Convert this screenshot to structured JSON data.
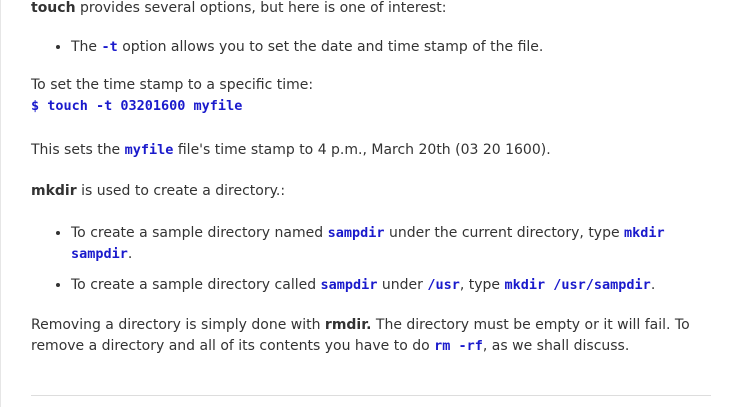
{
  "intro": {
    "cmd": "touch",
    "text": " provides several options, but here is one of interest:"
  },
  "list1": [
    {
      "pre": "The ",
      "code": "-t",
      "post": " option allows you to set the date and time stamp of the file."
    }
  ],
  "timestamp": {
    "label": "To set the time stamp to a specific time:",
    "command": "$ touch -t 03201600 myfile"
  },
  "sets": {
    "pre": "This sets the ",
    "code": "myfile",
    "post": " file's time stamp to 4 p.m., March 20th (03 20 1600)."
  },
  "mkdir": {
    "cmd": "mkdir",
    "text": " is used to create a directory.:"
  },
  "list2": [
    {
      "pre": "To create a sample directory named ",
      "code1": "sampdir",
      "mid": " under the current directory, type ",
      "code2": "mkdir sampdir",
      "post": "."
    },
    {
      "pre": "To create a sample directory called ",
      "code1": "sampdir",
      "mid1": " under ",
      "code2": "/usr",
      "mid2": ", type ",
      "code3": "mkdir /usr/sampdir",
      "post": "."
    }
  ],
  "rmdir": {
    "pre": "Removing a directory is simply done with ",
    "cmd": "rmdir.",
    "mid": " The directory must be empty or it will fail. To remove a directory and all of its contents you have to do ",
    "code": "rm -rf",
    "post": ", as we shall discuss."
  }
}
